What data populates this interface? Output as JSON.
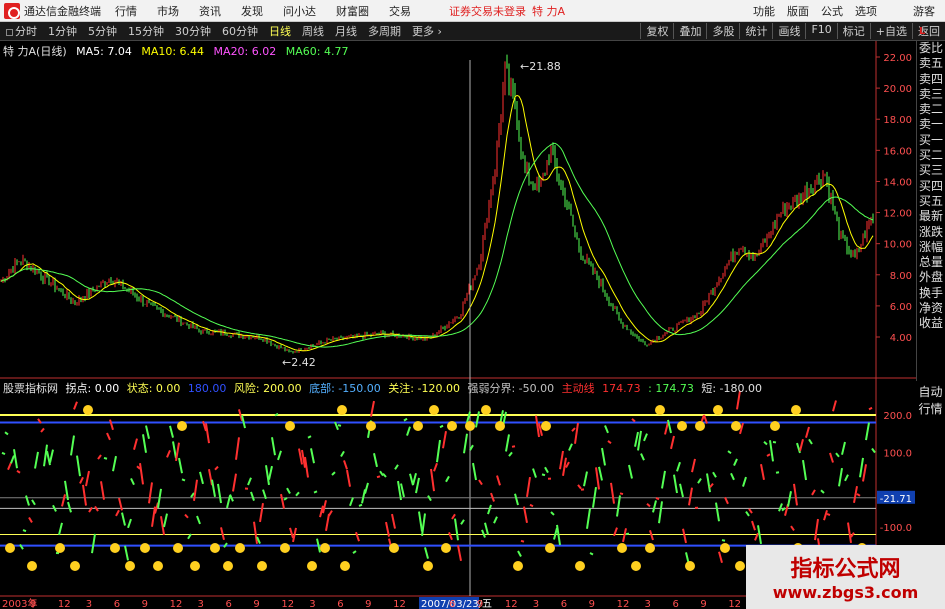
{
  "menubar": {
    "app_title": "通达信金融终端",
    "items": [
      "行情",
      "市场",
      "资讯",
      "发现",
      "问小达",
      "财富圈",
      "交易"
    ],
    "login_status": "证券交易未登录",
    "stock_name": "特 力A",
    "right_items": [
      "功能",
      "版面",
      "公式",
      "选项"
    ],
    "guest": "游客"
  },
  "toolbar": {
    "tabs": [
      "分时",
      "1分钟",
      "5分钟",
      "15分钟",
      "30分钟",
      "60分钟",
      "日线",
      "周线",
      "月线",
      "多周期",
      "更多 ›"
    ],
    "active_tab": "日线",
    "right": [
      "复权",
      "叠加",
      "多股",
      "统计",
      "画线",
      "F10",
      "标记",
      "+自选",
      "返回"
    ]
  },
  "corner_badge": "L",
  "ma_legend": {
    "name": "特 力A(日线)",
    "ma5": "MA5: 7.04",
    "ma10": "MA10: 6.44",
    "ma20": "MA20: 6.02",
    "ma60": "MA60: 4.77"
  },
  "side_tabs": [
    "委比",
    "卖五",
    "卖四",
    "卖三",
    "卖二",
    "卖一",
    "买一",
    "买二",
    "买三",
    "买四",
    "买五",
    "最新",
    "涨跌",
    "涨幅",
    "总量",
    "外盘",
    "换手",
    "净资",
    "收益"
  ],
  "side_tabs2": [
    "自动",
    "行情"
  ],
  "ind_legend": {
    "name": "股票指标网",
    "v1": "拐点: 0.00",
    "v2": "状态: 0.00",
    "v3": "180.00",
    "v4": "风险: 200.00",
    "v5": "底部: -150.00",
    "v6": "关注: -120.00",
    "v7": "强弱分界: -50.00",
    "v8": "主动线",
    "v9": "174.73",
    "v10": ": 174.73",
    "v11": "短: -180.00"
  },
  "price_axis": [
    "22.00",
    "20.00",
    "18.00",
    "16.00",
    "14.00",
    "12.00",
    "10.00",
    "8.00",
    "6.00",
    "4.00"
  ],
  "ind_axis": [
    "200.0",
    "100.0",
    "-21.71",
    "-100.0"
  ],
  "annotations": {
    "high": "21.88",
    "low": "2.42"
  },
  "time_axis": {
    "labels": [
      "2003年",
      "9",
      "12",
      "3",
      "6",
      "9",
      "12",
      "3",
      "6",
      "9",
      "12",
      "3",
      "6",
      "9",
      "12",
      "2007/03/23/五",
      "6",
      "9",
      "12",
      "3",
      "6",
      "9",
      "12",
      "3",
      "6",
      "9",
      "12",
      "3",
      "6",
      "9",
      "12"
    ]
  },
  "watermark": {
    "line1": "指标公式网",
    "line2": "www.zbgs3.com"
  },
  "colors": {
    "up": "#ff3030",
    "down": "#54ff54",
    "ma5": "#ffffff",
    "ma10": "#ffff00",
    "ma20": "#ff54ff",
    "ma60": "#54ff54",
    "risk": "#ffff54",
    "bottom": "#3050ff"
  }
}
